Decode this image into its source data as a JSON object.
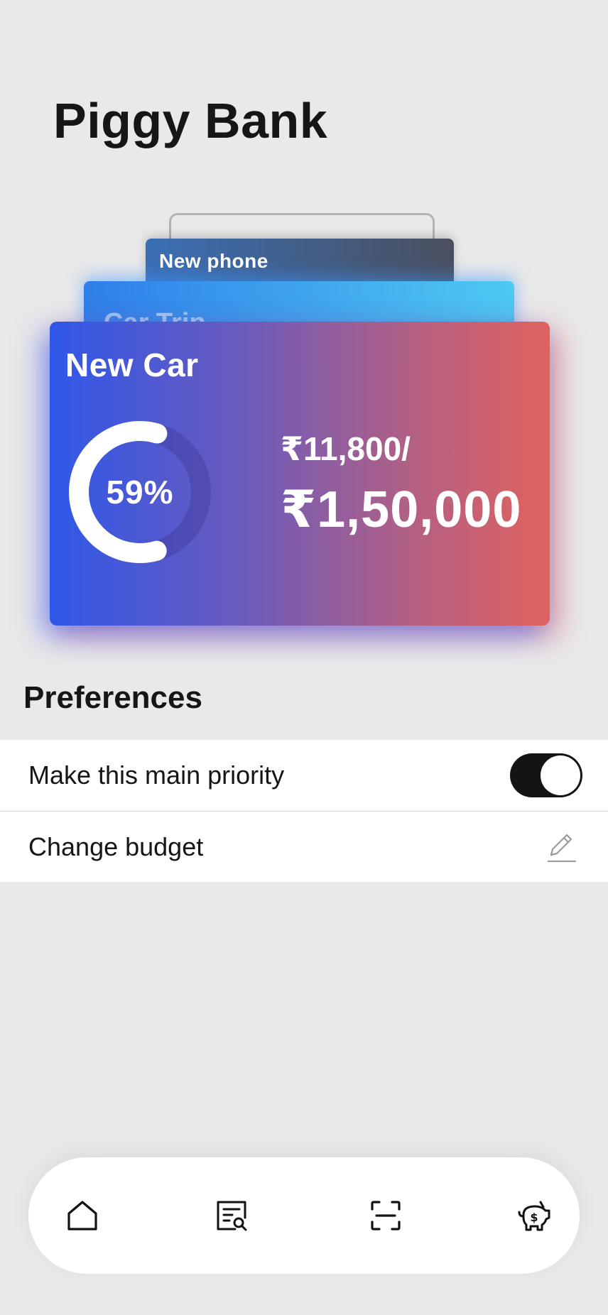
{
  "app": {
    "title": "Piggy Bank"
  },
  "cards": {
    "back_label": "New phone",
    "middle_label": "Car Trip",
    "main": {
      "name": "New Car",
      "progress_percent": 59,
      "progress_label": "59%",
      "saved": "₹11,800/",
      "target": "₹1,50,000"
    }
  },
  "preferences": {
    "heading": "Preferences",
    "items": [
      {
        "label": "Make this main priority",
        "control": "toggle",
        "value": true
      },
      {
        "label": "Change budget",
        "control": "edit-icon"
      }
    ]
  },
  "tabbar": {
    "items": [
      {
        "icon": "home-icon"
      },
      {
        "icon": "search-document-icon"
      },
      {
        "icon": "scan-icon"
      },
      {
        "icon": "piggy-bank-icon"
      }
    ]
  },
  "colors": {
    "background": "#e9e9e9",
    "text": "#161616",
    "card_gradient_start": "#2f57e8",
    "card_gradient_end": "#e0625f",
    "toggle_on": "#141414"
  }
}
